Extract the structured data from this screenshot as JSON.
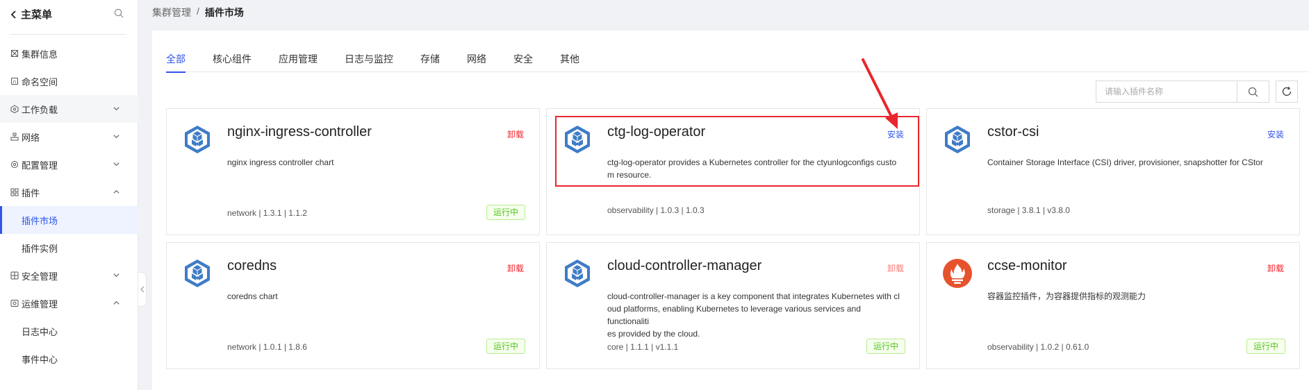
{
  "sidebar": {
    "back_label": "主菜单",
    "items": [
      {
        "label": "集群信息",
        "icon": "cluster-icon"
      },
      {
        "label": "命名空间",
        "icon": "namespace-icon"
      },
      {
        "label": "工作负载",
        "icon": "workload-icon"
      },
      {
        "label": "网络",
        "icon": "network-icon"
      },
      {
        "label": "配置管理",
        "icon": "config-icon"
      },
      {
        "label": "插件",
        "icon": "plugin-icon"
      },
      {
        "label": "插件市场"
      },
      {
        "label": "插件实例"
      },
      {
        "label": "安全管理",
        "icon": "security-icon"
      },
      {
        "label": "运维管理",
        "icon": "ops-icon"
      },
      {
        "label": "日志中心"
      },
      {
        "label": "事件中心"
      }
    ]
  },
  "breadcrumb": {
    "parent": "集群管理",
    "separator": "/",
    "current": "插件市场"
  },
  "tabs": [
    "全部",
    "核心组件",
    "应用管理",
    "日志与监控",
    "存储",
    "网络",
    "安全",
    "其他"
  ],
  "search": {
    "placeholder": "请输入插件名称",
    "value": ""
  },
  "colors": {
    "accent": "#2f54eb",
    "uninstall": "#f5222d",
    "running": "#52c41a",
    "annotation": "#e8262c"
  },
  "plugins": [
    {
      "name": "nginx-ingress-controller",
      "action": "卸载",
      "description": "nginx ingress controller chart",
      "meta": "network | 1.3.1 | 1.1.2",
      "status": "运行中",
      "logo": "kubernetes-cube-icon"
    },
    {
      "name": "ctg-log-operator",
      "action": "安装",
      "description_line1": "ctg-log-operator provides a Kubernetes controller for the ctyunlogconfigs custo",
      "description_line2": "m resource.",
      "meta": "observability | 1.0.3 | 1.0.3",
      "logo": "kubernetes-cube-icon"
    },
    {
      "name": "cstor-csi",
      "action": "安装",
      "description": "Container Storage Interface (CSI) driver, provisioner, snapshotter for CStor",
      "meta": "storage | 3.8.1 | v3.8.0",
      "logo": "kubernetes-cube-icon"
    },
    {
      "name": "coredns",
      "action": "卸载",
      "description": "coredns chart",
      "meta": "network | 1.0.1 | 1.8.6",
      "status": "运行中",
      "logo": "kubernetes-cube-icon"
    },
    {
      "name": "cloud-controller-manager",
      "action": "卸载",
      "description_line1": "cloud-controller-manager is a key component that integrates Kubernetes with cl",
      "description_line2": "oud platforms, enabling Kubernetes to leverage various services and functionaliti",
      "description_line3": "es provided by the cloud.",
      "meta": "core | 1.1.1 | v1.1.1",
      "status": "运行中",
      "logo": "kubernetes-cube-icon"
    },
    {
      "name": "ccse-monitor",
      "action": "卸载",
      "description": "容器监控插件，为容器提供指标的观测能力",
      "meta": "observability | 1.0.2 | 0.61.0",
      "status": "运行中",
      "logo": "prometheus-flame-icon"
    }
  ]
}
